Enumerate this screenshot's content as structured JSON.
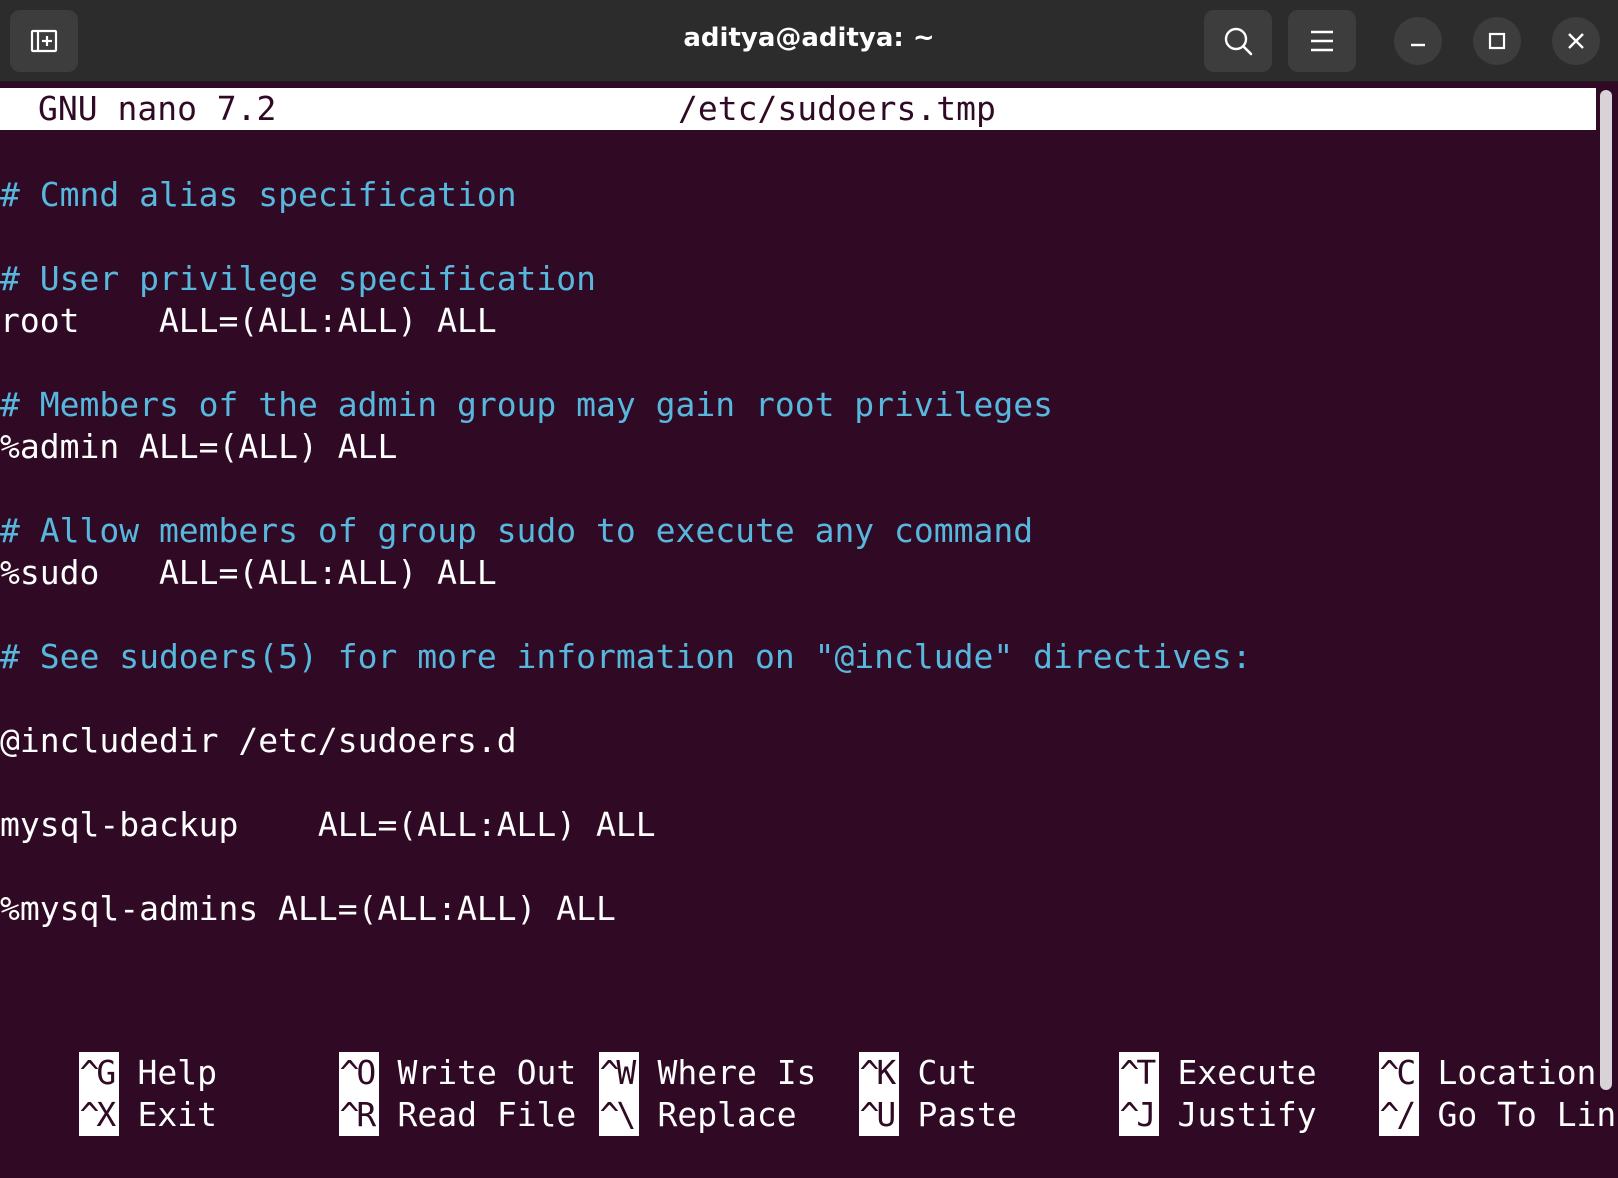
{
  "window": {
    "title": "aditya@aditya: ~",
    "new_tab_icon": "new-tab-icon",
    "search_icon": "search-icon",
    "menu_icon": "hamburger-menu-icon",
    "minimize_icon": "minimize-icon",
    "maximize_icon": "maximize-icon",
    "close_icon": "close-icon"
  },
  "nano": {
    "version": "GNU nano 7.2",
    "filename": "/etc/sudoers.tmp"
  },
  "lines": [
    {
      "text": "# Cmnd alias specification",
      "kind": "comment"
    },
    {
      "text": "# User privilege specification",
      "kind": "comment"
    },
    {
      "text": "root    ALL=(ALL:ALL) ALL",
      "kind": "code"
    },
    {
      "text": "# Members of the admin group may gain root privileges",
      "kind": "comment"
    },
    {
      "text": "%admin ALL=(ALL) ALL",
      "kind": "code"
    },
    {
      "text": "# Allow members of group sudo to execute any command",
      "kind": "comment"
    },
    {
      "text": "%sudo   ALL=(ALL:ALL) ALL",
      "kind": "code"
    },
    {
      "text": "# See sudoers(5) for more information on \"@include\" directives:",
      "kind": "comment"
    },
    {
      "text": "@includedir /etc/sudoers.d",
      "kind": "code"
    },
    {
      "text": "mysql-backup    ALL=(ALL:ALL) ALL",
      "kind": "code"
    },
    {
      "text": "%mysql-admins ALL=(ALL:ALL) ALL",
      "kind": "code"
    }
  ],
  "shortcuts": [
    {
      "key": "^G",
      "label": "Help"
    },
    {
      "key": "^O",
      "label": "Write Out"
    },
    {
      "key": "^W",
      "label": "Where Is"
    },
    {
      "key": "^K",
      "label": "Cut"
    },
    {
      "key": "^T",
      "label": "Execute"
    },
    {
      "key": "^C",
      "label": "Location"
    },
    {
      "key": "^X",
      "label": "Exit"
    },
    {
      "key": "^R",
      "label": "Read File"
    },
    {
      "key": "^\\",
      "label": "Replace"
    },
    {
      "key": "^U",
      "label": "Paste"
    },
    {
      "key": "^J",
      "label": "Justify"
    },
    {
      "key": "^/",
      "label": "Go To Line"
    }
  ],
  "colors": {
    "terminal_bg": "#300a24",
    "comment": "#57b7dc",
    "text": "#ffffff",
    "titlebar_bg": "#2c2c2c"
  }
}
